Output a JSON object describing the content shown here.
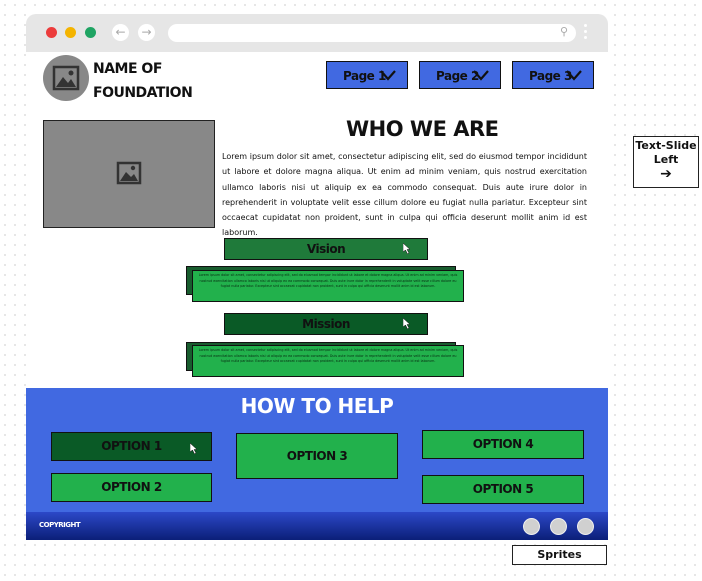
{
  "browser": {
    "dots": [
      "#ec3c3c",
      "#f4b400",
      "#1fa463"
    ]
  },
  "header": {
    "org_name": "Name of Foundation",
    "nav": [
      {
        "label": "Page 1"
      },
      {
        "label": "Page 2"
      },
      {
        "label": "Page 3"
      }
    ]
  },
  "about": {
    "title": "Who We Are",
    "body": "Lorem ipsum dolor sit amet, consectetur adipiscing elit, sed do eiusmod tempor incididunt ut labore et dolore magna aliqua. Ut enim ad minim veniam, quis nostrud exercitation ullamco laboris nisi ut aliquip ex ea commodo consequat. Duis aute irure dolor in reprehenderit in voluptate velit esse cillum dolore eu fugiat nulla pariatur. Excepteur sint occaecat cupidatat non proident, sunt in culpa qui officia deserunt mollit anim id est laborum.",
    "vision": {
      "label": "Vision",
      "body": "Lorem ipsum dolor sit amet, consectetur adipiscing elit, sed do eiusmod tempor incididunt ut labore et dolore magna aliqua. Ut enim ad minim veniam, quis nostrud exercitation ullamco laboris nisi ut aliquip ex ea commodo consequat. Duis aute irure dolor in reprehenderit in voluptate velit esse cillum dolore eu fugiat nulla pariatur. Excepteur sint occaecat cupidatat non proident, sunt in culpa qui officia deserunt mollit anim id est laborum."
    },
    "mission": {
      "label": "Mission",
      "body": "Lorem ipsum dolor sit amet, consectetur adipiscing elit, sed do eiusmod tempor incididunt ut labore et dolore magna aliqua. Ut enim ad minim veniam, quis nostrud exercitation ullamco laboris nisi ut aliquip ex ea commodo consequat. Duis aute irure dolor in reprehenderit in voluptate velit esse cillum dolore eu fugiat nulla pariatur. Excepteur sint occaecat cupidatat non proident, sunt in culpa qui officia deserunt mollit anim id est laborum."
    }
  },
  "help": {
    "title": "How to Help",
    "options": [
      "Option 1",
      "Option 2",
      "Option 3",
      "Option 4",
      "Option 5"
    ]
  },
  "footer": {
    "copyright": "COPYRIGHT"
  },
  "annotations": {
    "text_slide": "Text-Slide Left",
    "arrow": "➔",
    "sprites": "Sprites"
  },
  "colors": {
    "nav_button": "#4169e1",
    "help_bg": "#4169e1",
    "option_green": "#22b14c",
    "option_dark": "#0a5a26",
    "bar_green": "#1f7a3a"
  }
}
